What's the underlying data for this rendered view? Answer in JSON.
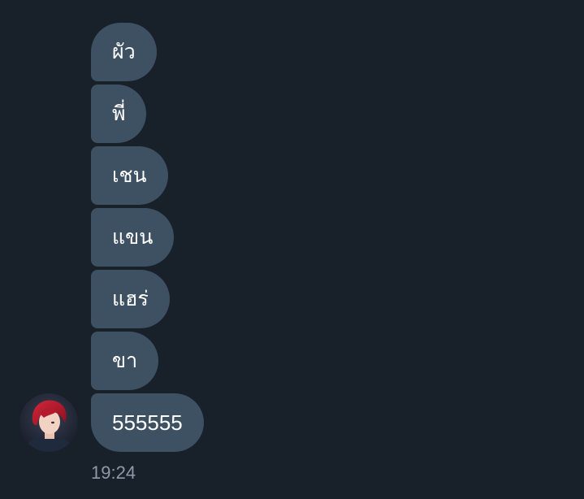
{
  "messages": [
    {
      "text": "ผัว"
    },
    {
      "text": "พี่"
    },
    {
      "text": "เชน"
    },
    {
      "text": "แขน"
    },
    {
      "text": "แฮร่"
    },
    {
      "text": "ขา"
    },
    {
      "text": "555555"
    }
  ],
  "message_time": "19:24",
  "avatar_icon": "user-avatar-icon"
}
